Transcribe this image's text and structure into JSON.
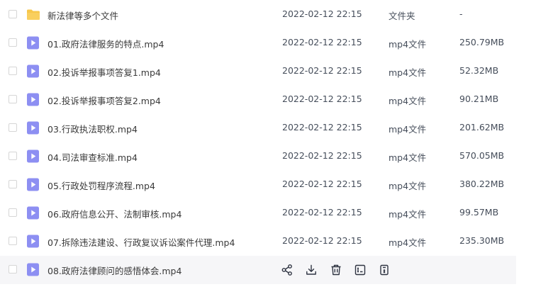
{
  "colors": {
    "folder": "#f7c74b",
    "video_icon": "#8d8ff2",
    "hover_row": "#f6f6f8",
    "action_icon": "#2f3442"
  },
  "files": [
    {
      "name": "新法律等多个文件",
      "date": "2022-02-12 22:15",
      "type": "文件夹",
      "size": "-",
      "icon": "folder-icon"
    },
    {
      "name": "01.政府法律服务的特点.mp4",
      "date": "2022-02-12 22:15",
      "type": "mp4文件",
      "size": "250.79MB",
      "icon": "video-file-icon"
    },
    {
      "name": "02.投诉举报事项答复1.mp4",
      "date": "2022-02-12 22:15",
      "type": "mp4文件",
      "size": "52.32MB",
      "icon": "video-file-icon"
    },
    {
      "name": "02.投诉举报事项答复2.mp4",
      "date": "2022-02-12 22:15",
      "type": "mp4文件",
      "size": "90.21MB",
      "icon": "video-file-icon"
    },
    {
      "name": "03.行政执法职权.mp4",
      "date": "2022-02-12 22:15",
      "type": "mp4文件",
      "size": "201.62MB",
      "icon": "video-file-icon"
    },
    {
      "name": "04.司法审查标准.mp4",
      "date": "2022-02-12 22:15",
      "type": "mp4文件",
      "size": "570.05MB",
      "icon": "video-file-icon"
    },
    {
      "name": "05.行政处罚程序流程.mp4",
      "date": "2022-02-12 22:15",
      "type": "mp4文件",
      "size": "380.22MB",
      "icon": "video-file-icon"
    },
    {
      "name": "06.政府信息公开、法制审核.mp4",
      "date": "2022-02-12 22:15",
      "type": "mp4文件",
      "size": "99.57MB",
      "icon": "video-file-icon"
    },
    {
      "name": "07.拆除违法建设、行政复议诉讼案件代理.mp4",
      "date": "2022-02-12 22:15",
      "type": "mp4文件",
      "size": "235.30MB",
      "icon": "video-file-icon"
    }
  ],
  "hover_file": {
    "name": "08.政府法律顾问的感悟体会.mp4",
    "icon": "video-file-icon",
    "actions": [
      "share-icon",
      "download-icon",
      "delete-icon",
      "rename-icon",
      "more-icon"
    ]
  }
}
